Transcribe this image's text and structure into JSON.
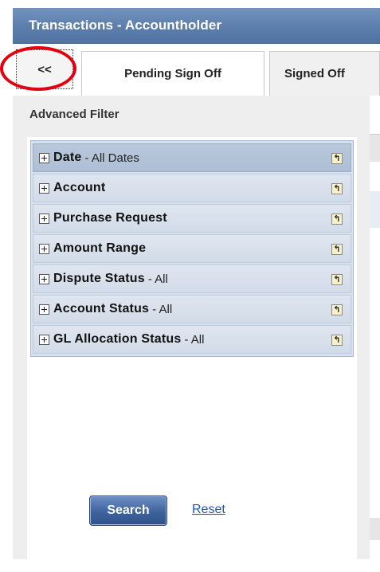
{
  "window": {
    "title": "Transactions - Accountholder"
  },
  "tabs": {
    "collapse_label": "<<",
    "items": [
      {
        "label": "Pending Sign Off"
      },
      {
        "label": "Signed Off"
      }
    ]
  },
  "filter": {
    "title": "Advanced Filter",
    "rows": [
      {
        "label": "Date",
        "value": "- All Dates"
      },
      {
        "label": "Account",
        "value": ""
      },
      {
        "label": "Purchase Request",
        "value": ""
      },
      {
        "label": "Amount Range",
        "value": ""
      },
      {
        "label": "Dispute Status",
        "value": "- All"
      },
      {
        "label": "Account Status",
        "value": "- All"
      },
      {
        "label": "GL Allocation Status",
        "value": "- All"
      }
    ],
    "search_label": "Search",
    "reset_label": "Reset"
  },
  "colors": {
    "titlebar": "#5c7eab",
    "highlight_circle": "#e3000f",
    "search_button": "#3e639d",
    "link": "#1f56a8"
  }
}
